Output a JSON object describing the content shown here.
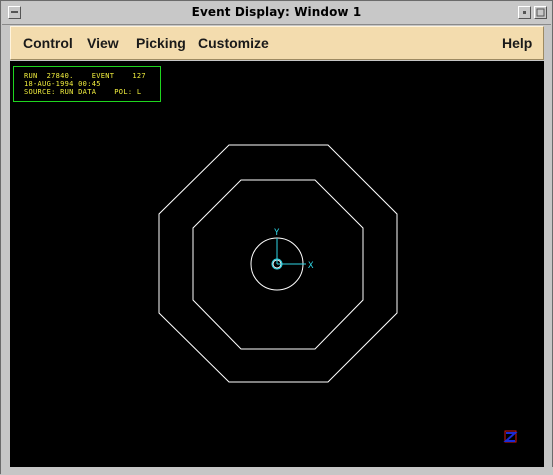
{
  "window": {
    "title": "Event Display:  Window 1"
  },
  "menubar": {
    "items": [
      {
        "label": "Control"
      },
      {
        "label": "View"
      },
      {
        "label": "Picking"
      },
      {
        "label": "Customize"
      }
    ],
    "help_label": "Help"
  },
  "info_panel": {
    "line1": "RUN  27840.    EVENT    127",
    "line2": "18-AUG-1994 00:45",
    "line3": "SOURCE: RUN DATA    POL: L"
  },
  "display": {
    "axis_y_label": "Y",
    "axis_x_label": "X",
    "colors": {
      "background": "#000000",
      "detector_outline": "#ffffff",
      "axes": "#2fd6e6",
      "info_text": "#f2ef3e",
      "info_border": "#1fd51f",
      "menubar": "#f3dcae"
    }
  },
  "icons": {
    "window_controls": [
      "minimize-icon",
      "maximize-icon"
    ],
    "corner_logo": "z-logo-icon"
  }
}
